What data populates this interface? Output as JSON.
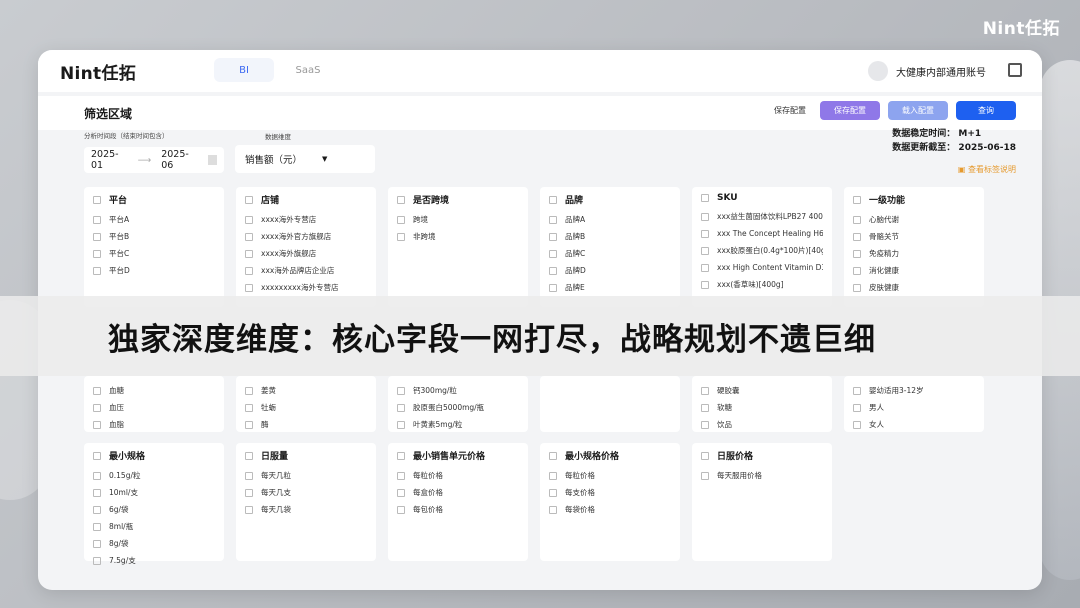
{
  "brand_corner": "Nint任拓",
  "app": {
    "logo": "Nint任拓",
    "tabs": [
      "BI",
      "SaaS"
    ],
    "user": "大健康内部通用账号"
  },
  "filter": {
    "title": "筛选区域",
    "save_config": "保存配置",
    "btn_save": "保存配置",
    "btn_load": "载入配置",
    "btn_query": "查询",
    "period_label": "分析时间段（结束时间包含）",
    "date_start": "2025-01",
    "date_arrow": "⟶",
    "date_end": "2025-06",
    "dim_label": "数据维度",
    "dim_value": "销售额（元）",
    "dim_caret": "▼",
    "stable_time": "数据稳定时间：  M+1",
    "update_time": "数据更新截至：  2025-06-18",
    "tag_link": "查看标签说明"
  },
  "cards_row1": [
    {
      "title": "平台",
      "options": [
        "平台A",
        "平台B",
        "平台C",
        "平台D"
      ]
    },
    {
      "title": "店铺",
      "options": [
        "xxxx海外专营店",
        "xxxx海外官方旗舰店",
        "xxxx海外旗舰店",
        "xxx海外品牌店企业店",
        "xxxxxxxxx海外专营店"
      ]
    },
    {
      "title": "是否跨境",
      "options": [
        "跨境",
        "非跨境"
      ]
    },
    {
      "title": "品牌",
      "options": [
        "品牌A",
        "品牌B",
        "品牌C",
        "品牌D",
        "品牌E"
      ]
    },
    {
      "title": "SKU",
      "options": [
        "xxx益生菌固体饮料LPB27 400",
        "xxx The Concept Healing H6/H",
        "xxx胶原蛋白(0.4g*100片)[40g]",
        "xxx High Content Vitamin D3 5",
        "xxx(香草味)[400g]"
      ]
    },
    {
      "title": "一级功能",
      "options": [
        "心脑代谢",
        "骨骼关节",
        "免疫精力",
        "消化健康",
        "皮肤健康"
      ]
    }
  ],
  "cards_row2": [
    {
      "options": [
        "血糖",
        "血压",
        "血脂"
      ]
    },
    {
      "options": [
        "姜黄",
        "牡蛎",
        "酶"
      ]
    },
    {
      "options": [
        "钙300mg/粒",
        "胶原蛋白5000mg/瓶",
        "叶黄素5mg/粒"
      ]
    },
    {
      "options": []
    },
    {
      "options": [
        "硬胶囊",
        "软糖",
        "饮品"
      ]
    },
    {
      "options": [
        "婴幼适用3-12岁",
        "男人",
        "女人"
      ]
    }
  ],
  "cards_row3": [
    {
      "title": "最小规格",
      "options": [
        "0.15g/粒",
        "10ml/支",
        "6g/袋",
        "8ml/瓶",
        "8g/袋",
        "7.5g/支"
      ]
    },
    {
      "title": "日服量",
      "options": [
        "每天几粒",
        "每天几支",
        "每天几袋"
      ]
    },
    {
      "title": "最小销售单元价格",
      "options": [
        "每粒价格",
        "每盒价格",
        "每包价格"
      ]
    },
    {
      "title": "最小规格价格",
      "options": [
        "每粒价格",
        "每支价格",
        "每袋价格"
      ]
    },
    {
      "title": "日服价格",
      "options": [
        "每天服用价格"
      ]
    }
  ],
  "banner_text": "独家深度维度：核心字段一网打尽，战略规划不遗巨细"
}
